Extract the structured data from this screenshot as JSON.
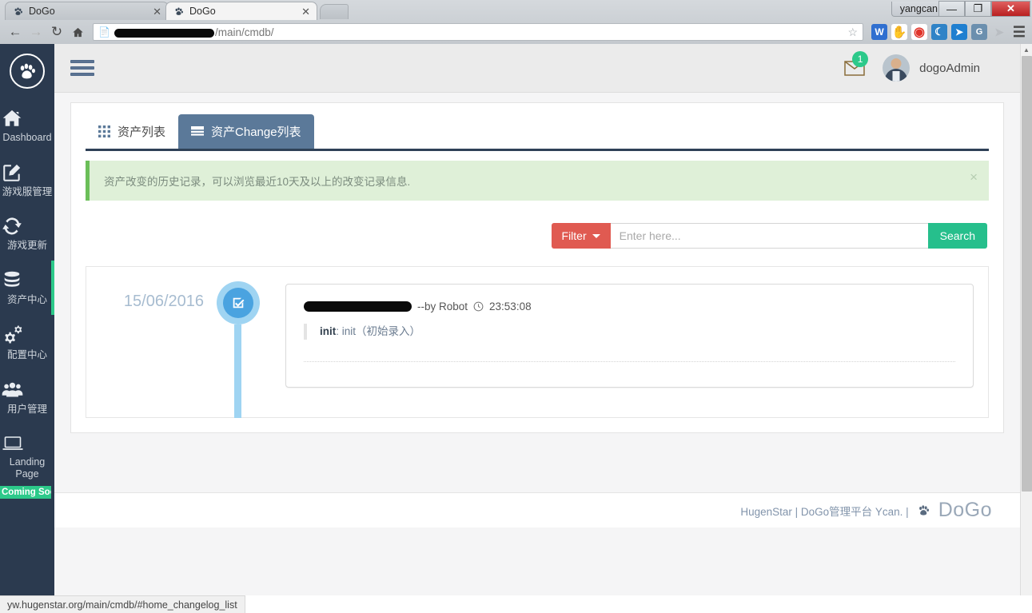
{
  "browser": {
    "tabs": [
      {
        "title": "DoGo",
        "favicon": "paw-icon",
        "active": false
      },
      {
        "title": "DoGo",
        "favicon": "paw-icon",
        "active": true
      }
    ],
    "window_user": "yangcan",
    "window_buttons": {
      "minimize": "—",
      "maximize": "❐",
      "close": "✕"
    },
    "nav": {
      "back": "←",
      "forward": "→",
      "reload": "↻",
      "home": "⌂"
    },
    "address": {
      "redacted": true,
      "path": "/main/cmdb/",
      "bookmark_star": "☆"
    },
    "extensions": [
      {
        "name": "w-extension",
        "glyph": "W",
        "color": "#2f6fd0"
      },
      {
        "name": "adblock-extension",
        "glyph": "✋",
        "color": "#d93025"
      },
      {
        "name": "weibo-extension",
        "glyph": "◉",
        "color": "#e0342a"
      },
      {
        "name": "blue-moon-extension",
        "glyph": "☾",
        "color": "#2f83c7"
      },
      {
        "name": "xunlei-extension",
        "glyph": "✈",
        "color": "#1f7fd0"
      },
      {
        "name": "google-translate-extension",
        "glyph": "G",
        "color": "#6b8fae"
      },
      {
        "name": "cursor-extension",
        "glyph": "➤",
        "color": "#b9bdc2"
      },
      {
        "name": "menu-extension",
        "glyph": "≡",
        "color": "#5a5a5a"
      }
    ],
    "status_bar_url": "yw.hugenstar.org/main/cmdb/#home_changelog_list"
  },
  "sidebar": {
    "logo_icon": "paw-logo-icon",
    "items": [
      {
        "label": "Dashboard",
        "icon": "home-icon",
        "active": false
      },
      {
        "label": "游戏服管理",
        "icon": "edit-square-icon",
        "active": false
      },
      {
        "label": "游戏更新",
        "icon": "refresh-icon",
        "active": false
      },
      {
        "label": "资产中心",
        "icon": "database-icon",
        "active": true
      },
      {
        "label": "配置中心",
        "icon": "gears-icon",
        "active": false
      },
      {
        "label": "用户管理",
        "icon": "users-icon",
        "active": false
      },
      {
        "label": "Landing Page",
        "icon": "laptop-icon",
        "active": false,
        "badge": "Coming Soon"
      }
    ]
  },
  "topbar": {
    "menu_toggle_icon": "hamburger-icon",
    "mail_icon": "envelope-icon",
    "mail_badge": "1",
    "avatar_icon": "user-avatar",
    "username": "dogoAdmin"
  },
  "main": {
    "tabs": [
      {
        "label": "资产列表",
        "icon": "grid-icon",
        "active": false
      },
      {
        "label": "资产Change列表",
        "icon": "list-icon",
        "active": true
      }
    ],
    "alert": {
      "text": "资产改变的历史记录，可以浏览最近10天及以上的改变记录信息.",
      "close_label": "×"
    },
    "search": {
      "filter_label": "Filter",
      "placeholder": "Enter here...",
      "value": "",
      "search_label": "Search"
    },
    "timeline": [
      {
        "date": "15/06/2016",
        "marker_icon": "check-square-icon",
        "title_redacted": true,
        "author": "--by Robot",
        "clock_icon": "clock-icon",
        "time": "23:53:08",
        "detail_key": "init",
        "detail_value": ": init（初始录入）"
      }
    ]
  },
  "footer": {
    "text": "HugenStar | DoGo管理平台 Ycan. |",
    "paw_icon": "paw-icon",
    "logo_text": "DoGo"
  },
  "colors": {
    "sidebar_bg": "#2b3a4f",
    "accent_green": "#2cc98a",
    "active_tab": "#5b7999",
    "filter_red": "#e05a51",
    "search_green": "#26bf8c",
    "timeline_blue": "#4aa3e0",
    "timeline_blue_light": "#9fd4f2",
    "alert_bg": "#dff0d8"
  }
}
